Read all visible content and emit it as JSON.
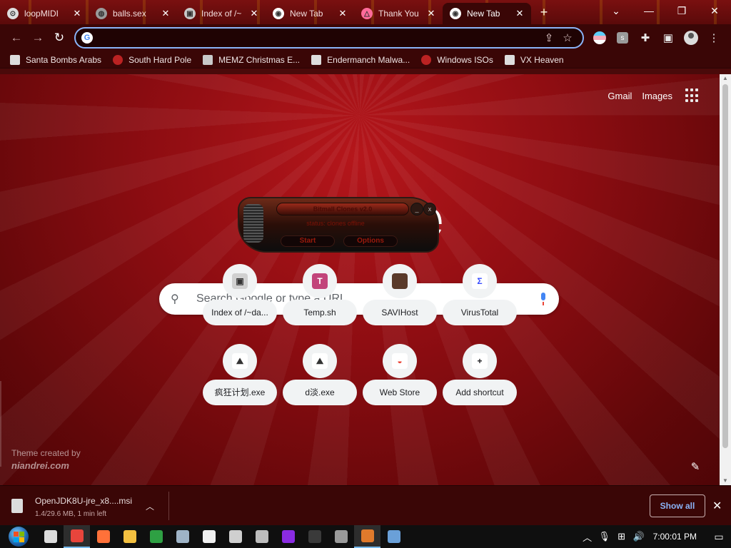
{
  "tabs": [
    {
      "title": "loopMIDI",
      "favicon": "loopmidi-icon",
      "fav_glyph": "⊙",
      "fav_color": "#dddddd"
    },
    {
      "title": "balls.sex",
      "favicon": "globe-icon",
      "fav_glyph": "◍",
      "fav_color": "#9a9a9a"
    },
    {
      "title": "Index of /~",
      "favicon": "computer-icon",
      "fav_glyph": "▣",
      "fav_color": "#c9c9c9"
    },
    {
      "title": "New Tab",
      "favicon": "chrome-icon",
      "fav_glyph": "◉",
      "fav_color": "#ffffff"
    },
    {
      "title": "Thank You",
      "favicon": "triangle-logo-icon",
      "fav_glyph": "△",
      "fav_color": "#ff6b9a"
    },
    {
      "title": "New Tab",
      "favicon": "chrome-icon",
      "fav_glyph": "◉",
      "fav_color": "#ffffff"
    }
  ],
  "bookmarks": [
    {
      "label": "Santa Bombs Arabs",
      "icon": "santa-icon",
      "style": "star"
    },
    {
      "label": "South Hard Pole",
      "icon": "snowflake-icon",
      "style": "red"
    },
    {
      "label": "MEMZ Christmas E...",
      "icon": "page-icon",
      "style": ""
    },
    {
      "label": "Endermanch Malwa...",
      "icon": "enderman-icon",
      "style": "star"
    },
    {
      "label": "Windows ISOs",
      "icon": "windows-icon",
      "style": "red"
    },
    {
      "label": "VX Heaven",
      "icon": "vx-icon",
      "style": "star"
    }
  ],
  "omnibox": {
    "value": "",
    "placeholder": ""
  },
  "page": {
    "gmail": "Gmail",
    "images": "Images",
    "search_placeholder": "Search Google or type a URL",
    "theme_credit_line1": "Theme created by",
    "theme_credit_line2": "niandrei.com"
  },
  "widget": {
    "title": "Bitmall Clones v2.0",
    "status": "status: clones offline",
    "start": "Start",
    "options": "Options",
    "minimize": "_",
    "close": "x"
  },
  "shortcuts": [
    {
      "label": "Index of /~da...",
      "icon": "computer-icon",
      "glyph": "▣",
      "bg": "#d0d0d0",
      "fg": "#333333"
    },
    {
      "label": "Temp.sh",
      "icon": "temp-sh-icon",
      "glyph": "T",
      "bg": "#c2447a",
      "fg": "#ffffff"
    },
    {
      "label": "SAVIHost",
      "icon": "savihost-icon",
      "glyph": "●",
      "bg": "#5a3a2a",
      "fg": "#5a3a2a"
    },
    {
      "label": "VirusTotal",
      "icon": "virustotal-icon",
      "glyph": "Σ",
      "bg": "#ffffff",
      "fg": "#394eff"
    },
    {
      "label": "疯狂计划.exe",
      "icon": "exe-icon",
      "glyph": "⛰",
      "bg": "#ffffff",
      "fg": "#333333"
    },
    {
      "label": "d淡.exe",
      "icon": "exe-icon",
      "glyph": "⛰",
      "bg": "#ffffff",
      "fg": "#333333"
    },
    {
      "label": "Web Store",
      "icon": "web-store-icon",
      "glyph": "◒",
      "bg": "#ffffff",
      "fg": "#ea4335"
    },
    {
      "label": "Add shortcut",
      "icon": "plus-icon",
      "glyph": "+",
      "bg": "#ffffff",
      "fg": "#202124"
    }
  ],
  "download": {
    "filename": "OpenJDK8U-jre_x8....msi",
    "meta": "1.4/29.6 MB, 1 min left",
    "show_all": "Show all"
  },
  "taskbar": {
    "clock": "7:00:01 PM",
    "apps": [
      {
        "name": "task-view-icon",
        "color": "#dddddd",
        "active": false
      },
      {
        "name": "chrome-taskbar-icon",
        "color": "#e8453c",
        "active": true
      },
      {
        "name": "firefox-taskbar-icon",
        "color": "#ff7139",
        "active": false
      },
      {
        "name": "explorer-taskbar-icon",
        "color": "#f3c040",
        "active": false
      },
      {
        "name": "app-green-icon",
        "color": "#2ea043",
        "active": false
      },
      {
        "name": "app-network-icon",
        "color": "#9fb4c7",
        "active": false
      },
      {
        "name": "7zip-icon",
        "color": "#f0f0f0",
        "active": false
      },
      {
        "name": "app-round-icon",
        "color": "#cfcfcf",
        "active": false
      },
      {
        "name": "app-gear-icon",
        "color": "#bdbdbd",
        "active": false
      },
      {
        "name": "app-purple-icon",
        "color": "#8a2be2",
        "active": false
      },
      {
        "name": "cmd-icon",
        "color": "#3a3a3a",
        "active": false
      },
      {
        "name": "audio-app-icon",
        "color": "#9a9a9a",
        "active": false
      },
      {
        "name": "app-orange-icon",
        "color": "#e07a2c",
        "active": true
      },
      {
        "name": "app-monitor-icon",
        "color": "#6aa0d8",
        "active": false
      }
    ]
  }
}
